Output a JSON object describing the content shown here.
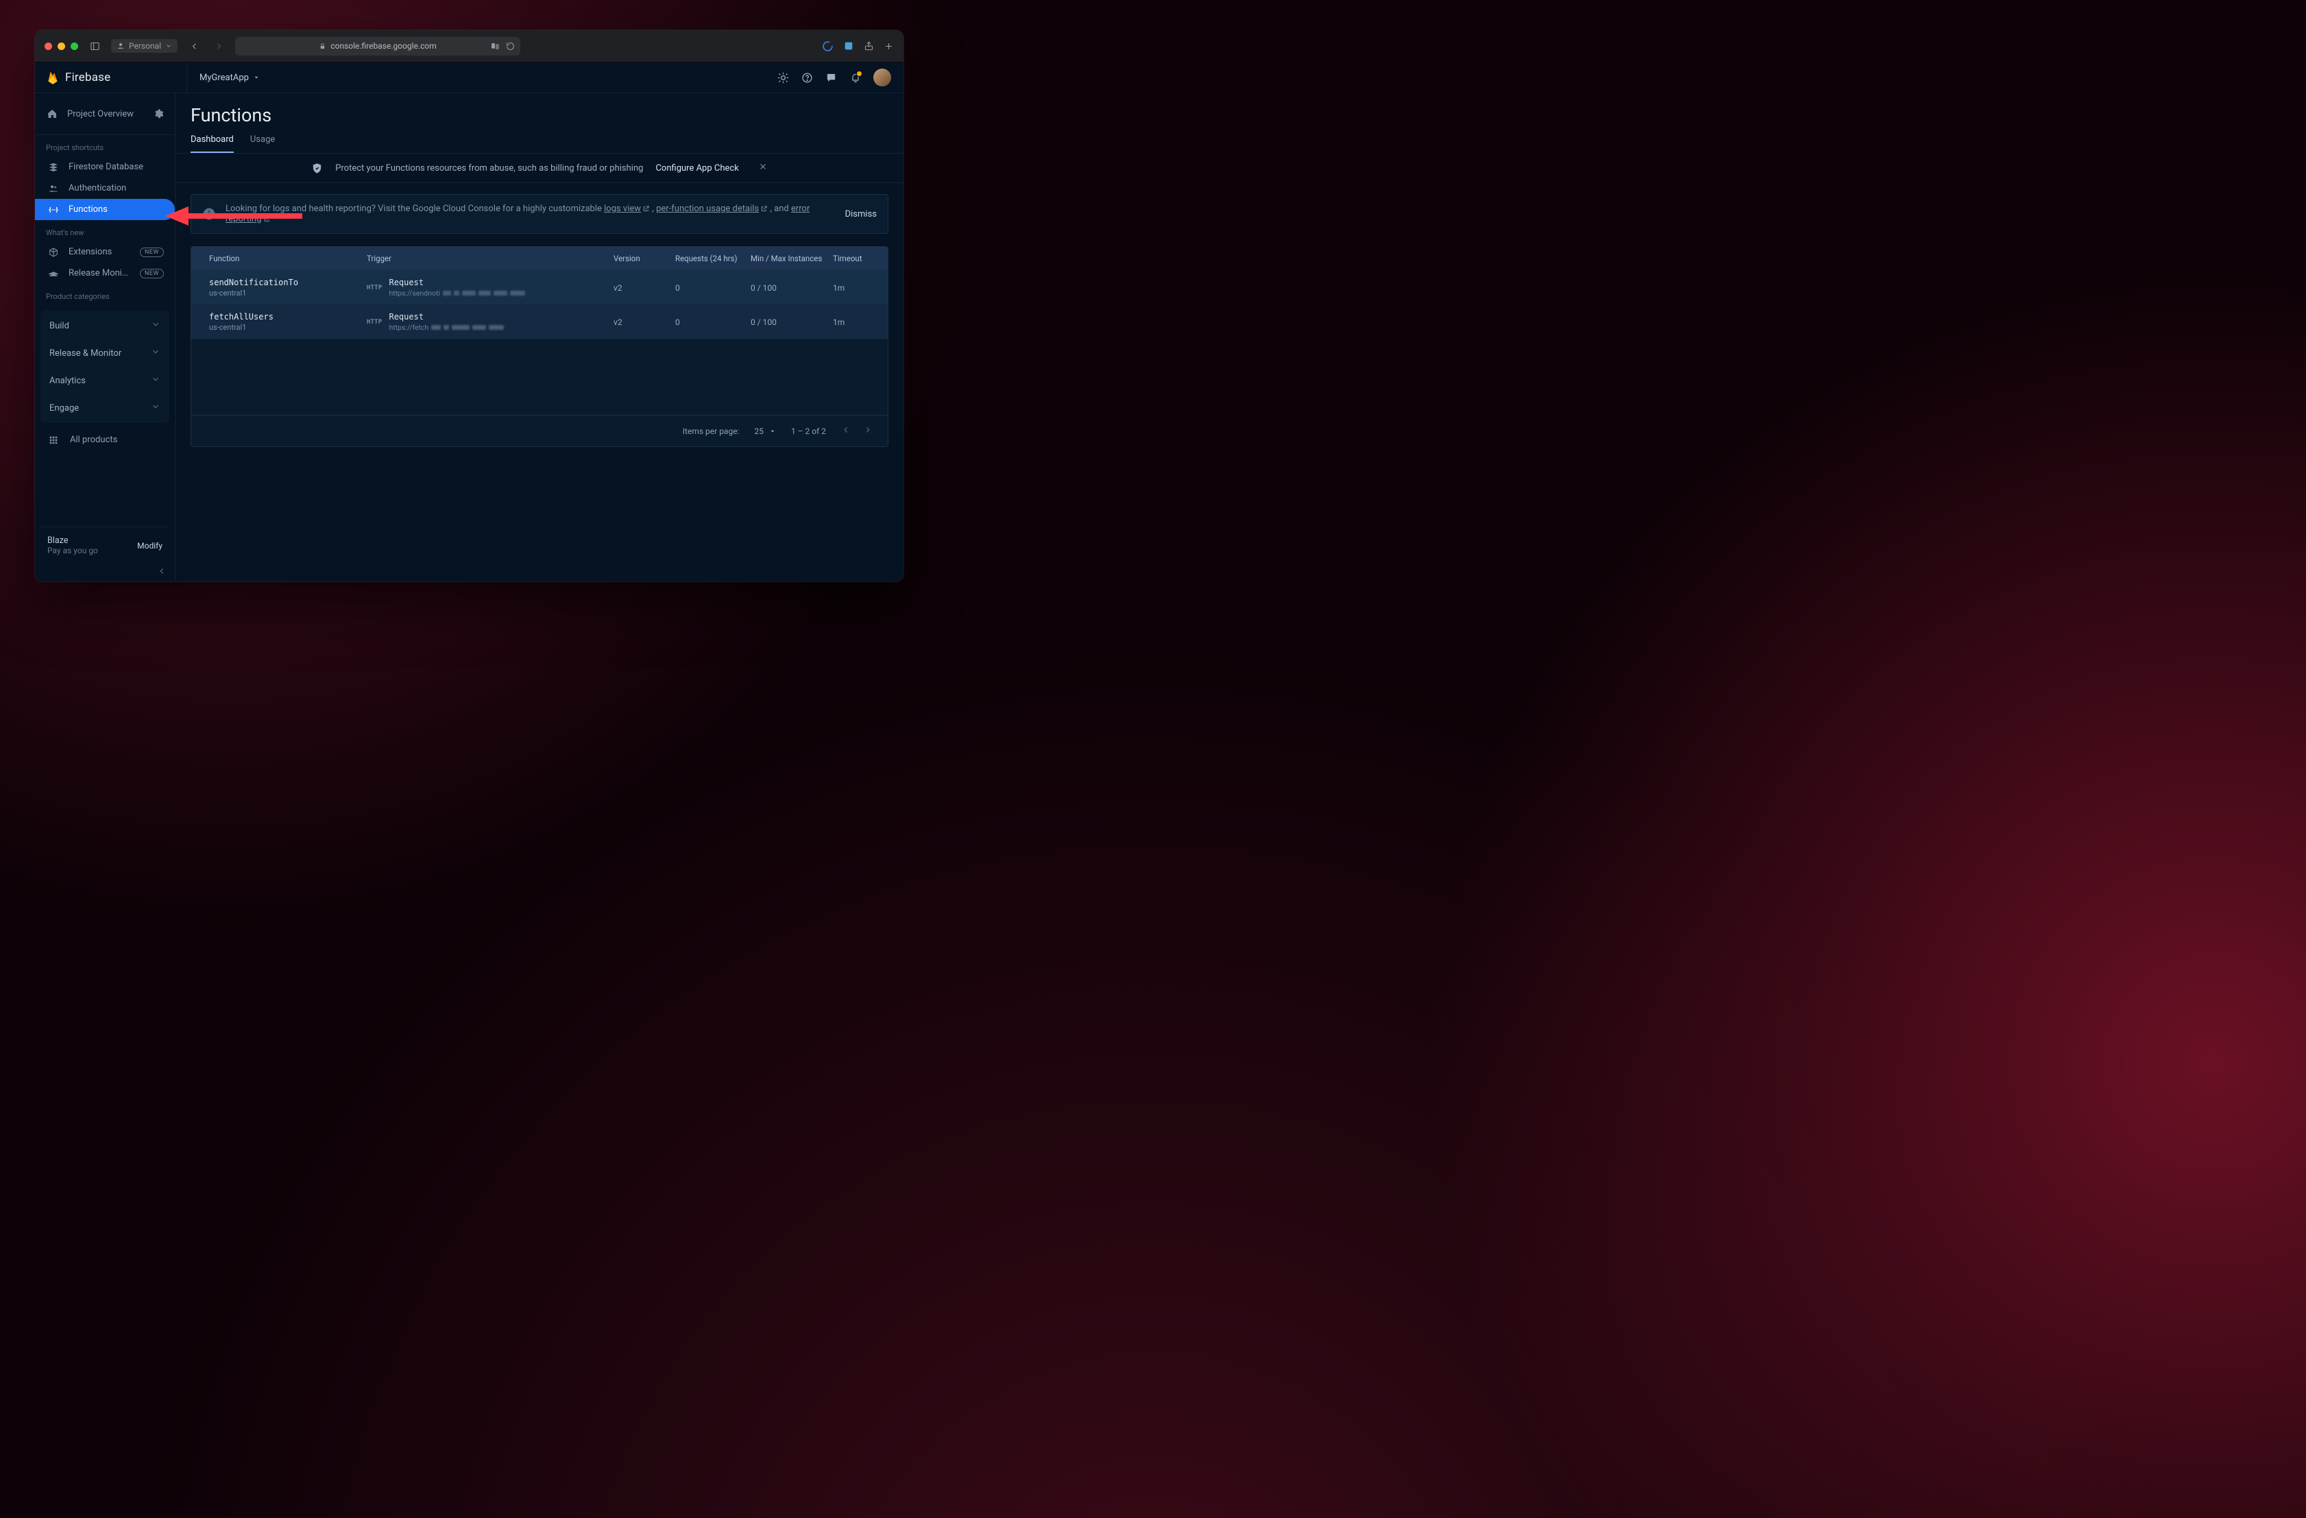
{
  "browser": {
    "profile_label": "Personal",
    "url_host": "console.firebase.google.com"
  },
  "header": {
    "brand": "Firebase",
    "project_name": "MyGreatApp"
  },
  "sidebar": {
    "overview": "Project Overview",
    "shortcuts_heading": "Project shortcuts",
    "shortcuts": [
      {
        "label": "Firestore Database"
      },
      {
        "label": "Authentication"
      },
      {
        "label": "Functions"
      }
    ],
    "whatsnew_heading": "What's new",
    "whatsnew": [
      {
        "label": "Extensions",
        "badge": "NEW"
      },
      {
        "label": "Release Monito…",
        "badge": "NEW"
      }
    ],
    "categories_heading": "Product categories",
    "categories": [
      "Build",
      "Release & Monitor",
      "Analytics",
      "Engage"
    ],
    "all_products": "All products",
    "plan_name": "Blaze",
    "plan_desc": "Pay as you go",
    "plan_modify": "Modify"
  },
  "page": {
    "title": "Functions",
    "tabs": [
      {
        "label": "Dashboard",
        "active": true
      },
      {
        "label": "Usage",
        "active": false
      }
    ],
    "banner_msg": "Protect your Functions resources from abuse, such as billing fraud or phishing",
    "banner_action": "Configure App Check",
    "notice_prefix": "Looking for logs and health reporting? Visit the Google Cloud Console for a highly customizable ",
    "notice_link1": "logs view",
    "notice_mid1": " , ",
    "notice_link2": "per-function usage details",
    "notice_mid2": " , and ",
    "notice_link3": "error reporting",
    "notice_dismiss": "Dismiss",
    "table": {
      "headers": [
        "Function",
        "Trigger",
        "Version",
        "Requests (24 hrs)",
        "Min / Max Instances",
        "Timeout"
      ],
      "rows": [
        {
          "name": "sendNotificationTo",
          "region": "us-central1",
          "trigger_type": "Request",
          "url_prefix": "https://sendnoti",
          "version": "v2",
          "requests": "0",
          "instances": "0 / 100",
          "timeout": "1m"
        },
        {
          "name": "fetchAllUsers",
          "region": "us-central1",
          "trigger_type": "Request",
          "url_prefix": "https://fetch",
          "version": "v2",
          "requests": "0",
          "instances": "0 / 100",
          "timeout": "1m"
        }
      ],
      "items_per_page_label": "Items per page:",
      "items_per_page": "25",
      "range": "1 – 2 of 2"
    }
  }
}
